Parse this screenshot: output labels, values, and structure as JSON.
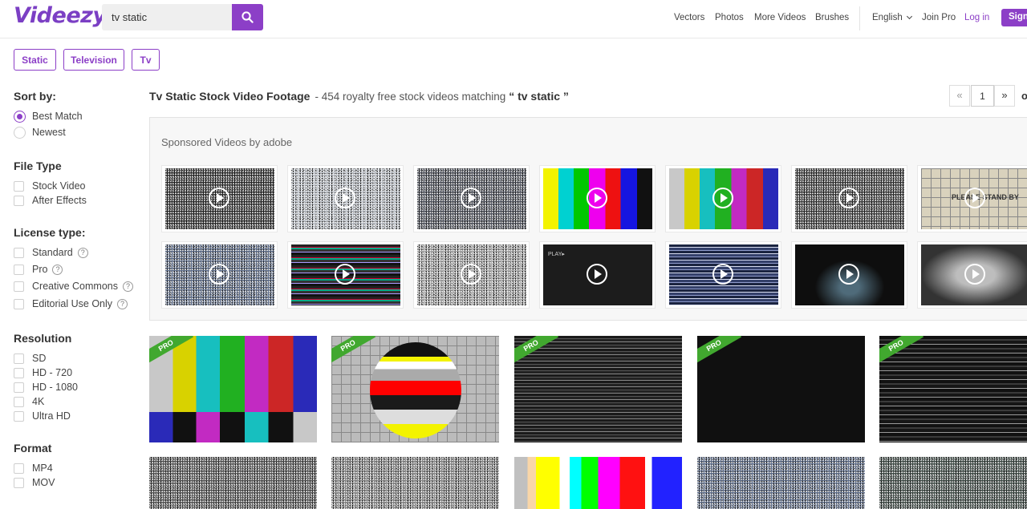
{
  "header": {
    "logo": "Videezy",
    "search_value": "tv static",
    "nav": [
      "Vectors",
      "Photos",
      "More Videos",
      "Brushes"
    ],
    "language": "English",
    "join_pro": "Join Pro",
    "login": "Log in",
    "signup": "Sign"
  },
  "tags": [
    "Static",
    "Television",
    "Tv"
  ],
  "sidebar": {
    "sort_heading": "Sort by:",
    "sort_options": [
      "Best Match",
      "Newest"
    ],
    "file_type_heading": "File Type",
    "file_types": [
      "Stock Video",
      "After Effects"
    ],
    "license_heading": "License type:",
    "licenses": [
      "Standard",
      "Pro",
      "Creative Commons",
      "Editorial Use Only"
    ],
    "resolution_heading": "Resolution",
    "resolutions": [
      "SD",
      "HD - 720",
      "HD - 1080",
      "4K",
      "Ultra HD"
    ],
    "format_heading": "Format",
    "formats": [
      "MP4",
      "MOV"
    ],
    "help_glyph": "?"
  },
  "results": {
    "title": "Tv Static Stock Video Footage",
    "summary": "- 454 royalty free stock videos matching",
    "query_open": "“ tv static ”"
  },
  "pager": {
    "page": "1",
    "prev": "«",
    "next": "»",
    "of": "o"
  },
  "sponsored": {
    "label": "Sponsored Videos by adobe",
    "overlay_text_1": "PLEASE STAND BY",
    "overlay_text_2": "PLAY▸"
  },
  "badge": {
    "pro": "PRO"
  }
}
